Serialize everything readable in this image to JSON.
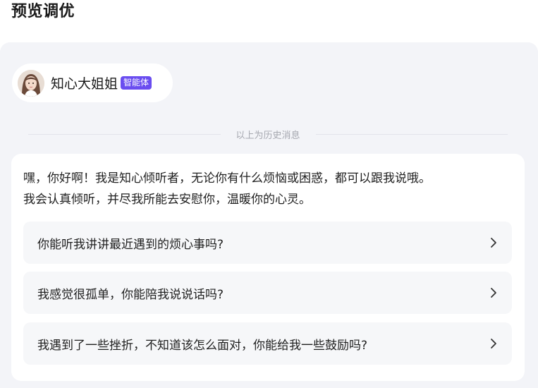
{
  "page": {
    "title": "预览调优"
  },
  "agent": {
    "name": "知心大姐姐",
    "badge": "智能体",
    "avatar_icon": "person-avatar-icon"
  },
  "history_divider": {
    "text": "以上为历史消息"
  },
  "message": {
    "greeting_line1": "嘿，你好啊！我是知心倾听者，无论你有什么烦恼或困惑，都可以跟我说哦。",
    "greeting_line2": "我会认真倾听，并尽我所能去安慰你，温暖你的心灵。",
    "suggestions": [
      {
        "text": "你能听我讲讲最近遇到的烦心事吗?",
        "icon": "chevron-right-icon"
      },
      {
        "text": "我感觉很孤单，你能陪我说说话吗?",
        "icon": "chevron-right-icon"
      },
      {
        "text": "我遇到了一些挫折，不知道该怎么面对，你能给我一些鼓励吗?",
        "icon": "chevron-right-icon"
      }
    ]
  },
  "colors": {
    "badge_bg": "#6a4df0",
    "panel_bg": "#f3f4f8",
    "suggestion_bg": "#f6f7f9"
  }
}
